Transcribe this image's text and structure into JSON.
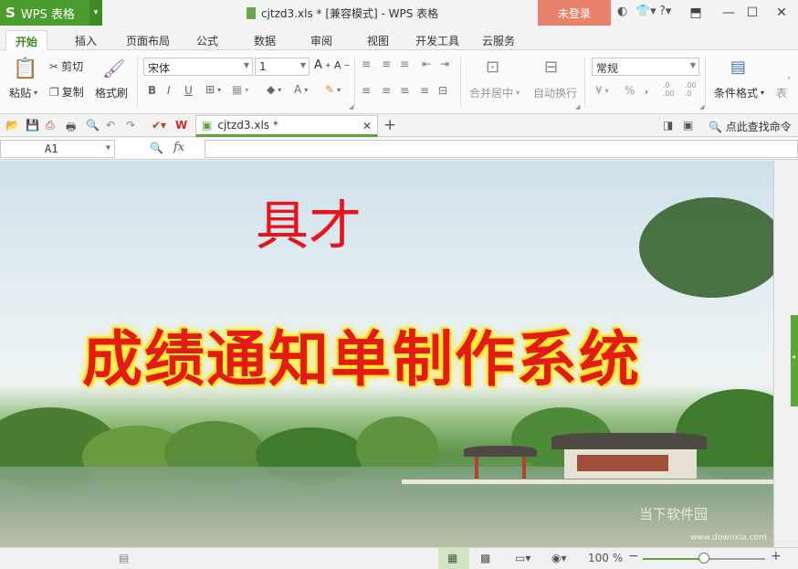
{
  "app": {
    "logo": "S",
    "name": "WPS 表格",
    "window_title": "cjtzd3.xls * [兼容模式] - WPS 表格",
    "login_label": "未登录",
    "help_label": "?"
  },
  "menu": {
    "tabs": [
      "开始",
      "插入",
      "页面布局",
      "公式",
      "数据",
      "审阅",
      "视图",
      "开发工具",
      "云服务"
    ],
    "active": "开始"
  },
  "ribbon": {
    "paste_label": "粘贴",
    "cut_label": "剪切",
    "copy_label": "复制",
    "format_painter_label": "格式刷",
    "font_name": "宋体",
    "font_size": "1",
    "merge_center_label": "合并居中",
    "wrap_text_label": "自动换行",
    "number_format": "常规",
    "conditional_format_label": "条件格式",
    "table_style_label": "表",
    "bold": "B",
    "italic": "I",
    "underline": "U",
    "percent": "%",
    "comma": ",",
    "dec_increase": ".0 .00",
    "dec_decrease": ".00 .0"
  },
  "doc_tab": {
    "filename": "cjtzd3.xls *",
    "find_command": "点此查找命令"
  },
  "formula_bar": {
    "cell_ref": "A1",
    "fx_label": "fx",
    "value": ""
  },
  "canvas": {
    "overlay_text": "具才",
    "banner_text": "成绩通知单制作系统",
    "watermark": "当下软件园",
    "watermark_sub": "www.downxia.com"
  },
  "status": {
    "zoom_label": "100 %",
    "zoom_value": 0.5,
    "minus": "−",
    "plus": "+"
  },
  "colors": {
    "brand_green": "#4a9d2e",
    "login_orange": "#e8826a",
    "banner_red": "#e31b12",
    "banner_glow": "#ffe600"
  }
}
